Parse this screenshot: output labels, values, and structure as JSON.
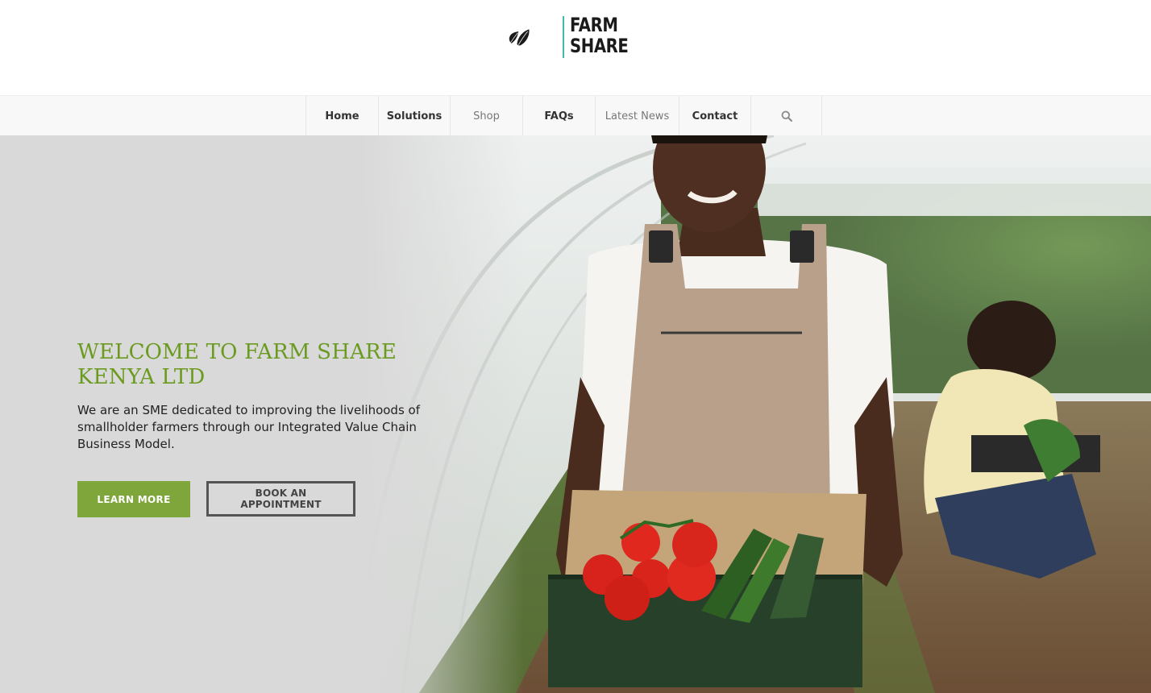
{
  "brand": {
    "name_line1": "FARM",
    "name_line2": "SHARE",
    "accent_divider": "#46b8b0"
  },
  "nav": {
    "items": [
      {
        "label": "Home"
      },
      {
        "label": "Solutions"
      },
      {
        "label": "Shop"
      },
      {
        "label": "FAQs"
      },
      {
        "label": "Latest News"
      },
      {
        "label": "Contact"
      }
    ],
    "search_icon": "search-icon"
  },
  "hero": {
    "title": "WELCOME TO FARM SHARE KENYA LTD",
    "description": "We are an SME dedicated to improving the livelihoods of smallholder farmers through our Integrated Value Chain Business Model.",
    "primary_button": "LEARN MORE",
    "secondary_button": "BOOK AN APPOINTMENT",
    "colors": {
      "title": "#6a9a1f",
      "primary_button_bg": "#7fa63a",
      "panel_bg": "#d9d9d9"
    }
  }
}
